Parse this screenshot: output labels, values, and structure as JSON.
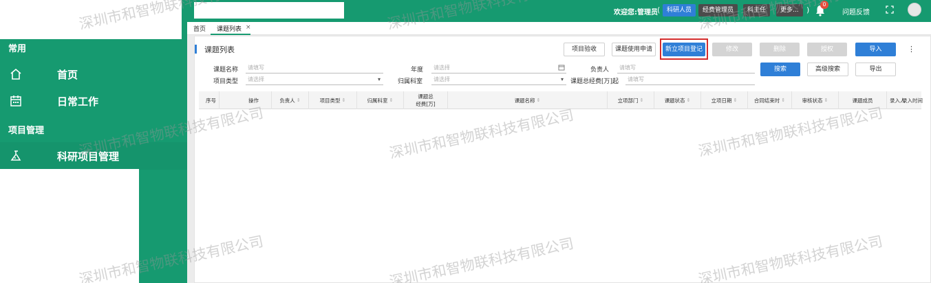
{
  "sidebar": {
    "groups": [
      "常用",
      "项目管理"
    ],
    "items": [
      {
        "label": "首页",
        "icon": "home-icon"
      },
      {
        "label": "日常工作",
        "icon": "calendar-icon"
      },
      {
        "label": "科研项目管理",
        "icon": "flask-icon"
      }
    ]
  },
  "header": {
    "welcome": "欢迎您:管理员",
    "paren_open": "(",
    "paren_close": ")",
    "roles": [
      "科研人员",
      "经费管理员",
      "科主任",
      "更多..."
    ],
    "notification_count": "0",
    "feedback": "问题反馈"
  },
  "tabs": [
    {
      "label": "首页"
    },
    {
      "label": "课题列表"
    }
  ],
  "tab_close": "×",
  "panel": {
    "title": "课题列表",
    "toolbar": {
      "acceptance": "项目验收",
      "usage_apply": "课题使用申请",
      "new_project": "新立项目登记",
      "edit": "修改",
      "delete": "删除",
      "authorize": "授权",
      "import": "导入",
      "more": "⋮"
    }
  },
  "filters": {
    "name_label": "课题名称",
    "name_placeholder": "请填写",
    "year_label": "年度",
    "year_placeholder": "请选择",
    "leader_label": "负责人",
    "leader_placeholder": "请填写",
    "type_label": "项目类型",
    "type_placeholder": "请选择",
    "dept_label": "归属科室",
    "dept_placeholder": "请选择",
    "funds_label": "课题总经费[万]起",
    "funds_placeholder": "请填写",
    "search": "搜索",
    "advanced": "高级搜索",
    "export": "导出"
  },
  "table": {
    "headers": [
      "序号",
      "操作",
      "负责人",
      "项目类型",
      "归属科室",
      "课题总经费[万]",
      "课题名称",
      "立项部门",
      "课题状态",
      "立项日期",
      "合同结束时",
      "审核状态",
      "课题成员",
      "录入人",
      "录入时间"
    ],
    "funds_header_lines": [
      "课题总",
      "经费[万]"
    ]
  },
  "watermark": "深圳市和智物联科技有限公司",
  "colors": {
    "brand_green": "#169a70",
    "primary_blue": "#2f7fd7",
    "highlight_red": "#d42b2b"
  }
}
